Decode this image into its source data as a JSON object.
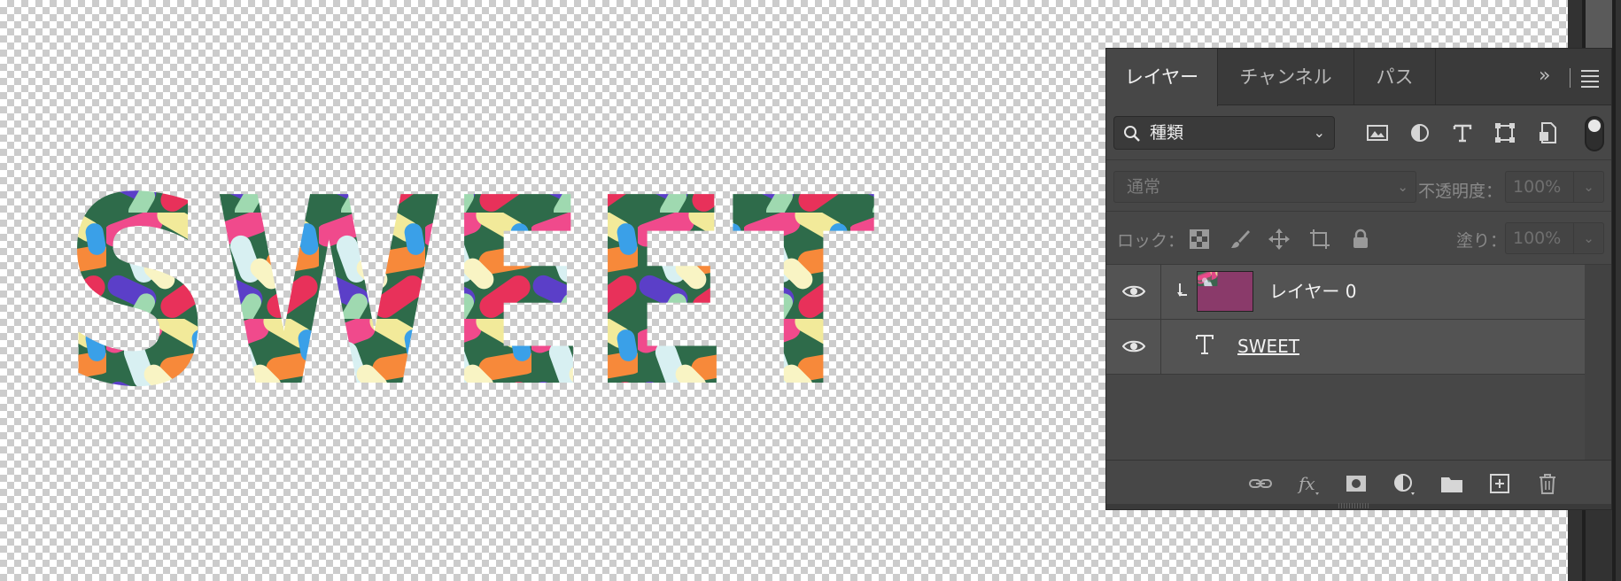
{
  "canvas": {
    "artwork_text": "SWEET"
  },
  "layers_panel": {
    "tabs": [
      {
        "label": "レイヤー",
        "active": true
      },
      {
        "label": "チャンネル",
        "active": false
      },
      {
        "label": "パス",
        "active": false
      }
    ],
    "collapse_icon": "double-chevron-right-icon",
    "menu_icon": "hamburger-menu-icon",
    "filter": {
      "selected": "種類",
      "icons": [
        "image-filter-icon",
        "adjustment-filter-icon",
        "type-filter-icon",
        "shape-filter-icon",
        "smart-object-filter-icon"
      ],
      "toggle_on": true
    },
    "blend_mode": "通常",
    "opacity_label": "不透明度：",
    "opacity_value": "100%",
    "lock_label": "ロック：",
    "lock_icons": [
      "lock-transparent-pixels-icon",
      "lock-image-pixels-icon",
      "lock-position-icon",
      "lock-artboard-icon",
      "lock-all-icon"
    ],
    "fill_label": "塗り：",
    "fill_value": "100%",
    "layers": [
      {
        "name": "レイヤー 0",
        "visible": true,
        "clipped": true,
        "kind": "pixel"
      },
      {
        "name": "SWEET",
        "visible": true,
        "clipped": false,
        "kind": "type"
      }
    ],
    "bottom_icons": [
      "link-layers-icon",
      "fx-icon",
      "add-mask-icon",
      "new-adjustment-layer-icon",
      "new-group-icon",
      "new-layer-icon",
      "delete-layer-icon"
    ]
  },
  "colors": {
    "panel_bg": "#474747",
    "tab_bar_bg": "#3a3a3a",
    "layer_row_bg": "#535353",
    "chrome_dark": "#323232"
  }
}
